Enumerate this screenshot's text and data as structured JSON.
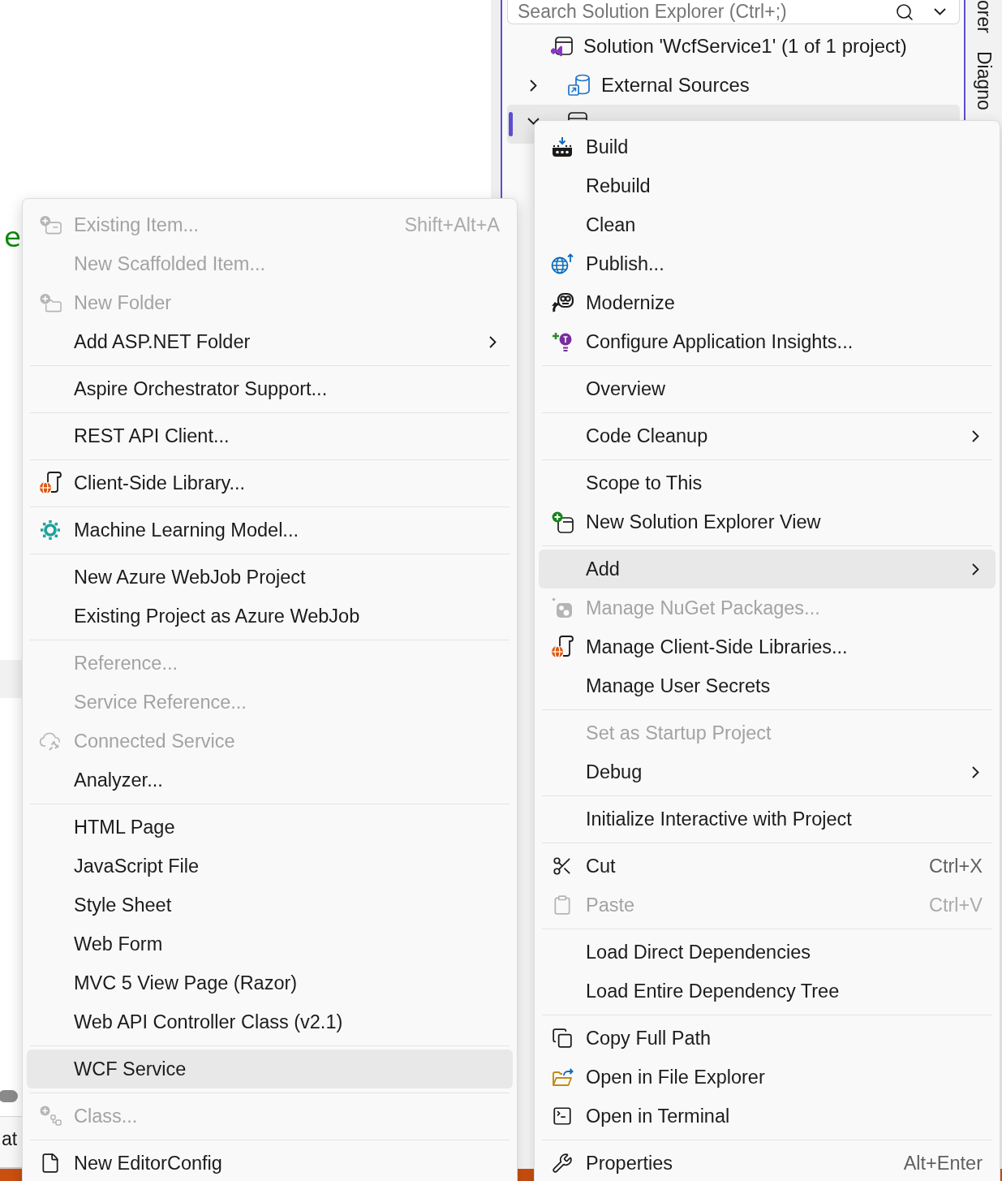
{
  "solution_explorer": {
    "search": {
      "placeholder": "Search Solution Explorer (Ctrl+;)"
    },
    "tree": [
      {
        "label": "Solution 'WcfService1' (1 of 1 project)",
        "selected": false,
        "children": [
          {
            "label": "External Sources",
            "expanded": false,
            "selected": false
          },
          {
            "expanded": true,
            "selected": true
          }
        ]
      }
    ]
  },
  "side_tabs": [
    "orer",
    "Diagno"
  ],
  "editor": {
    "text": "e"
  },
  "bottom_panel": {
    "tabs": [
      "at"
    ]
  },
  "context_menu": {
    "groups": [
      [
        {
          "label": "Build",
          "disabled": false,
          "submenu": false,
          "selected": false
        },
        {
          "label": "Rebuild",
          "disabled": false,
          "submenu": false,
          "selected": false
        },
        {
          "label": "Clean",
          "disabled": false,
          "submenu": false,
          "selected": false
        },
        {
          "label": "Publish...",
          "disabled": false,
          "submenu": false,
          "selected": false
        },
        {
          "label": "Modernize",
          "disabled": false,
          "submenu": false,
          "selected": false
        },
        {
          "label": "Configure Application Insights...",
          "disabled": false,
          "submenu": false,
          "selected": false
        }
      ],
      [
        {
          "label": "Overview",
          "disabled": false,
          "submenu": false,
          "selected": false
        }
      ],
      [
        {
          "label": "Code Cleanup",
          "disabled": false,
          "submenu": true,
          "selected": false
        }
      ],
      [
        {
          "label": "Scope to This",
          "disabled": false,
          "submenu": false,
          "selected": false
        },
        {
          "label": "New Solution Explorer View",
          "disabled": false,
          "submenu": false,
          "selected": false
        }
      ],
      [
        {
          "label": "Add",
          "disabled": false,
          "submenu": true,
          "selected": true
        },
        {
          "label": "Manage NuGet Packages...",
          "disabled": true,
          "submenu": false,
          "selected": false
        },
        {
          "label": "Manage Client-Side Libraries...",
          "disabled": false,
          "submenu": false,
          "selected": false
        },
        {
          "label": "Manage User Secrets",
          "disabled": false,
          "submenu": false,
          "selected": false
        }
      ],
      [
        {
          "label": "Set as Startup Project",
          "disabled": true,
          "submenu": false,
          "selected": false
        },
        {
          "label": "Debug",
          "disabled": false,
          "submenu": true,
          "selected": false
        }
      ],
      [
        {
          "label": "Initialize Interactive with Project",
          "disabled": false,
          "submenu": false,
          "selected": false
        }
      ],
      [
        {
          "label": "Cut",
          "shortcut": "Ctrl+X",
          "disabled": false,
          "submenu": false,
          "selected": false
        },
        {
          "label": "Paste",
          "shortcut": "Ctrl+V",
          "disabled": true,
          "submenu": false,
          "selected": false
        }
      ],
      [
        {
          "label": "Load Direct Dependencies",
          "disabled": false,
          "submenu": false,
          "selected": false
        },
        {
          "label": "Load Entire Dependency Tree",
          "disabled": false,
          "submenu": false,
          "selected": false
        }
      ],
      [
        {
          "label": "Copy Full Path",
          "disabled": false,
          "submenu": false,
          "selected": false
        },
        {
          "label": "Open in File Explorer",
          "disabled": false,
          "submenu": false,
          "selected": false
        },
        {
          "label": "Open in Terminal",
          "disabled": false,
          "submenu": false,
          "selected": false
        }
      ],
      [
        {
          "label": "Properties",
          "shortcut": "Alt+Enter",
          "disabled": false,
          "submenu": false,
          "selected": false
        }
      ]
    ]
  },
  "add_submenu": {
    "groups": [
      [
        {
          "label": "Existing Item...",
          "shortcut": "Shift+Alt+A",
          "disabled": true,
          "submenu": false,
          "selected": false
        },
        {
          "label": "New Scaffolded Item...",
          "disabled": true,
          "submenu": false,
          "selected": false
        },
        {
          "label": "New Folder",
          "disabled": true,
          "submenu": false,
          "selected": false
        },
        {
          "label": "Add ASP.NET Folder",
          "disabled": false,
          "submenu": true,
          "selected": false
        }
      ],
      [
        {
          "label": "Aspire Orchestrator Support...",
          "disabled": false,
          "submenu": false,
          "selected": false
        }
      ],
      [
        {
          "label": "REST API Client...",
          "disabled": false,
          "submenu": false,
          "selected": false
        }
      ],
      [
        {
          "label": "Client-Side Library...",
          "disabled": false,
          "submenu": false,
          "selected": false
        }
      ],
      [
        {
          "label": "Machine Learning Model...",
          "disabled": false,
          "submenu": false,
          "selected": false
        }
      ],
      [
        {
          "label": "New Azure WebJob Project",
          "disabled": false,
          "submenu": false,
          "selected": false
        },
        {
          "label": "Existing Project as Azure WebJob",
          "disabled": false,
          "submenu": false,
          "selected": false
        }
      ],
      [
        {
          "label": "Reference...",
          "disabled": true,
          "submenu": false,
          "selected": false
        },
        {
          "label": "Service Reference...",
          "disabled": true,
          "submenu": false,
          "selected": false
        },
        {
          "label": "Connected Service",
          "disabled": true,
          "submenu": false,
          "selected": false
        },
        {
          "label": "Analyzer...",
          "disabled": false,
          "submenu": false,
          "selected": false
        }
      ],
      [
        {
          "label": "HTML Page",
          "disabled": false,
          "submenu": false,
          "selected": false
        },
        {
          "label": "JavaScript File",
          "disabled": false,
          "submenu": false,
          "selected": false
        },
        {
          "label": "Style Sheet",
          "disabled": false,
          "submenu": false,
          "selected": false
        },
        {
          "label": "Web Form",
          "disabled": false,
          "submenu": false,
          "selected": false
        },
        {
          "label": "MVC 5 View Page (Razor)",
          "disabled": false,
          "submenu": false,
          "selected": false
        },
        {
          "label": "Web API Controller Class (v2.1)",
          "disabled": false,
          "submenu": false,
          "selected": false
        }
      ],
      [
        {
          "label": "WCF Service",
          "disabled": false,
          "submenu": false,
          "selected": true
        }
      ],
      [
        {
          "label": "Class...",
          "disabled": true,
          "submenu": false,
          "selected": false
        }
      ],
      [
        {
          "label": "New EditorConfig",
          "disabled": false,
          "submenu": false,
          "selected": false
        }
      ]
    ]
  }
}
